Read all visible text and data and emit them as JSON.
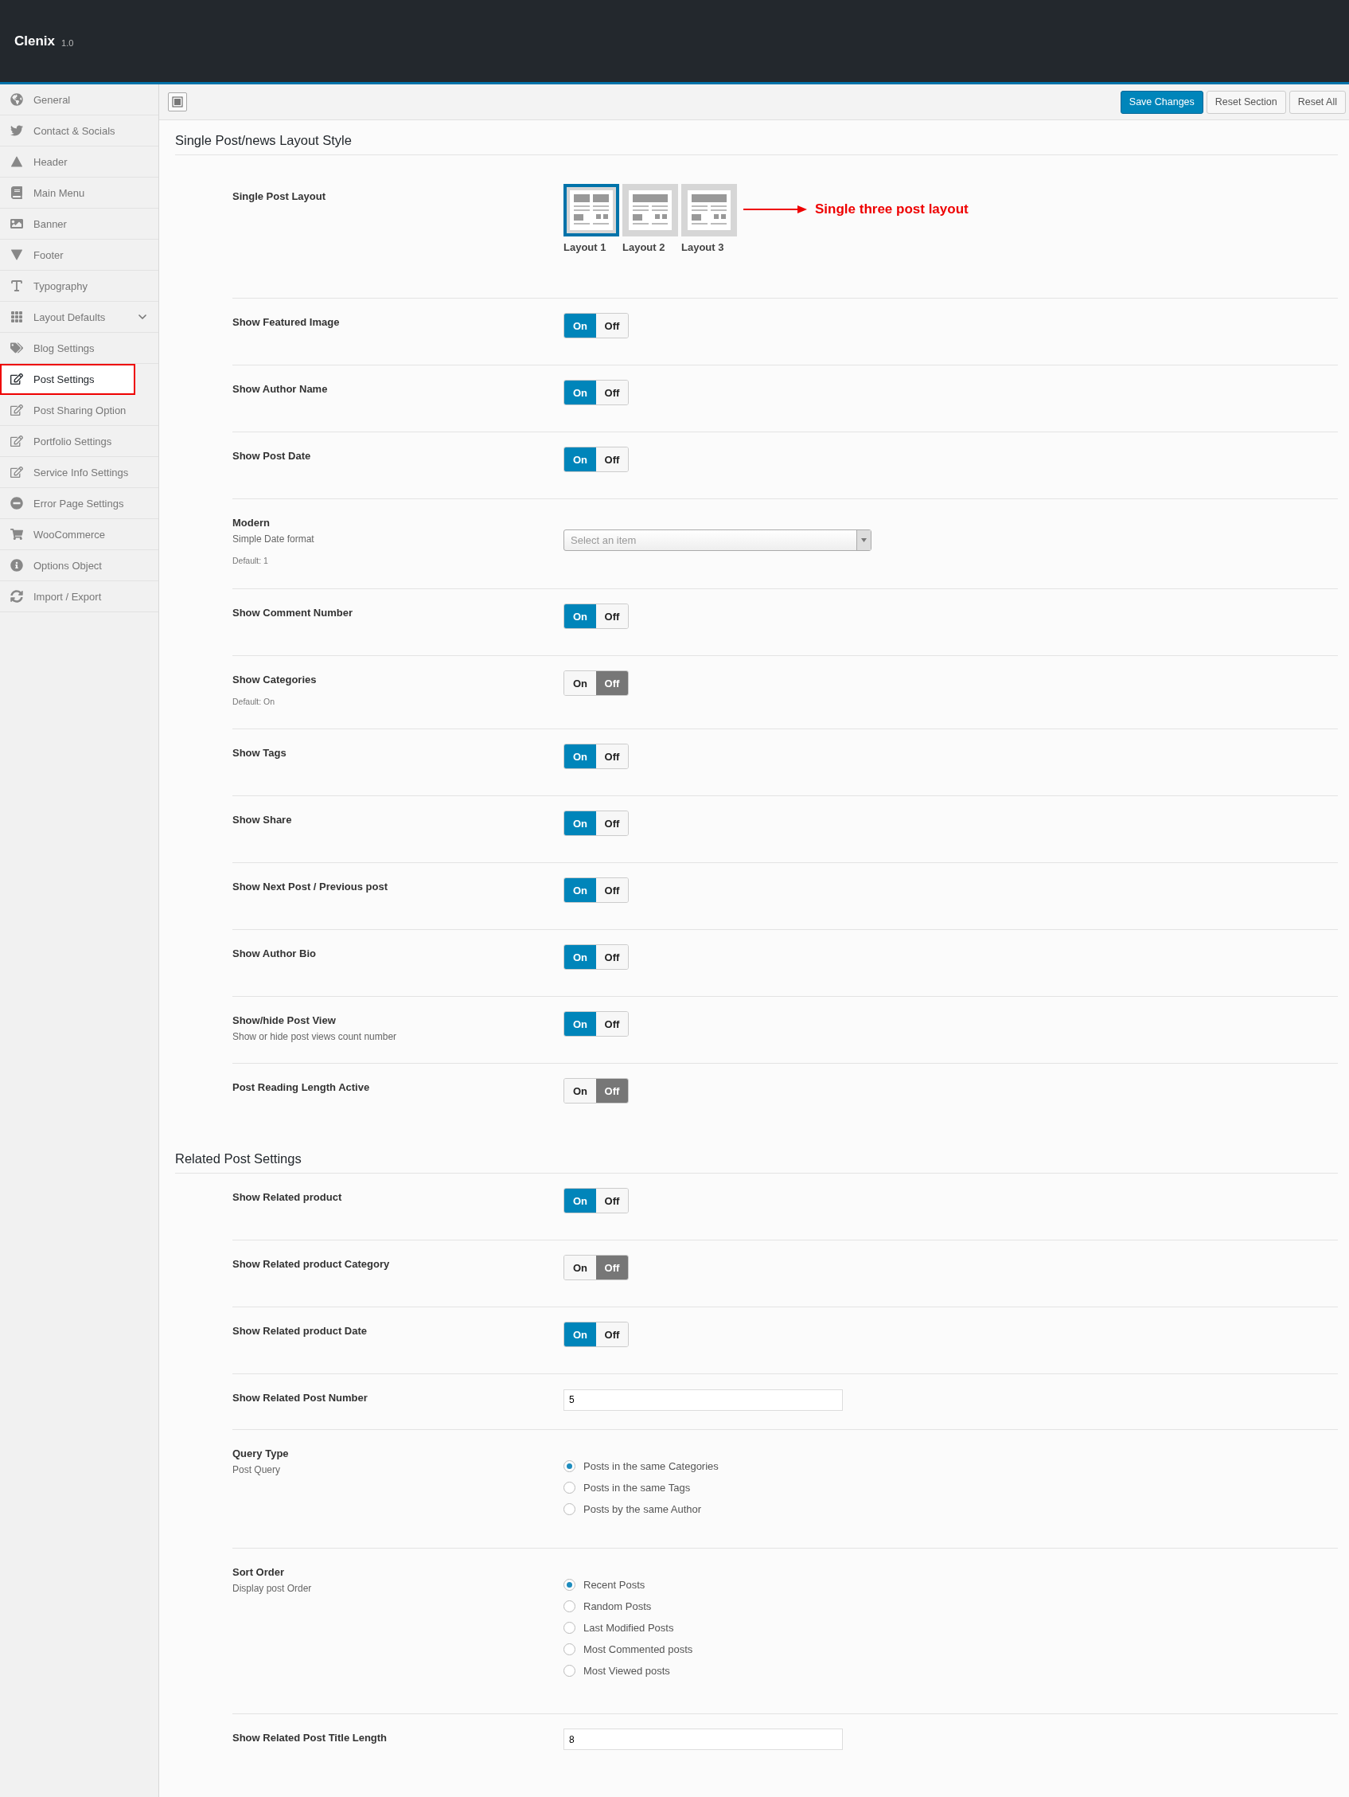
{
  "header": {
    "title": "Clenix",
    "version": "1.0"
  },
  "sidebar": {
    "items": [
      {
        "label": "General",
        "selected": false,
        "has_children": false
      },
      {
        "label": "Contact & Socials",
        "selected": false,
        "has_children": false
      },
      {
        "label": "Header",
        "selected": false,
        "has_children": false
      },
      {
        "label": "Main Menu",
        "selected": false,
        "has_children": false
      },
      {
        "label": "Banner",
        "selected": false,
        "has_children": false
      },
      {
        "label": "Footer",
        "selected": false,
        "has_children": false
      },
      {
        "label": "Typography",
        "selected": false,
        "has_children": false
      },
      {
        "label": "Layout Defaults",
        "selected": false,
        "has_children": true
      },
      {
        "label": "Blog Settings",
        "selected": false,
        "has_children": false
      },
      {
        "label": "Post Settings",
        "selected": true,
        "has_children": false
      },
      {
        "label": "Post Sharing Option",
        "selected": false,
        "has_children": false
      },
      {
        "label": "Portfolio Settings",
        "selected": false,
        "has_children": false
      },
      {
        "label": "Service Info Settings",
        "selected": false,
        "has_children": false
      },
      {
        "label": "Error Page Settings",
        "selected": false,
        "has_children": false
      },
      {
        "label": "WooCommerce",
        "selected": false,
        "has_children": false
      },
      {
        "label": "Options Object",
        "selected": false,
        "has_children": false
      },
      {
        "label": "Import / Export",
        "selected": false,
        "has_children": false
      }
    ]
  },
  "toolbar": {
    "buttons": [
      {
        "label": "Save Changes",
        "kind": "primary"
      },
      {
        "label": "Reset Section",
        "kind": "secondary"
      },
      {
        "label": "Reset All",
        "kind": "secondary"
      }
    ]
  },
  "sections": [
    {
      "title": "Single Post/news Layout Style",
      "fields": [
        {
          "kind": "layout",
          "label": "Single Post Layout",
          "annotation": "Single three post layout",
          "options": [
            {
              "label": "Layout 1",
              "selected": true
            },
            {
              "label": "Layout 2",
              "selected": false
            },
            {
              "label": "Layout 3",
              "selected": false
            }
          ]
        },
        {
          "kind": "toggle",
          "label": "Show Featured Image",
          "on": true,
          "on_label": "On",
          "off_label": "Off"
        },
        {
          "kind": "toggle",
          "label": "Show Author Name",
          "on": true,
          "on_label": "On",
          "off_label": "Off"
        },
        {
          "kind": "toggle",
          "label": "Show Post Date",
          "on": true,
          "on_label": "On",
          "off_label": "Off"
        },
        {
          "kind": "select",
          "label": "Modern",
          "subtitle": "Simple Date format",
          "note": "Default: 1",
          "placeholder": "Select an item"
        },
        {
          "kind": "toggle",
          "label": "Show Comment Number",
          "on": true,
          "on_label": "On",
          "off_label": "Off"
        },
        {
          "kind": "toggle",
          "label": "Show Categories",
          "note": "Default: On",
          "on": false,
          "on_label": "On",
          "off_label": "Off"
        },
        {
          "kind": "toggle",
          "label": "Show Tags",
          "on": true,
          "on_label": "On",
          "off_label": "Off"
        },
        {
          "kind": "toggle",
          "label": "Show Share",
          "on": true,
          "on_label": "On",
          "off_label": "Off"
        },
        {
          "kind": "toggle",
          "label": "Show Next Post / Previous post",
          "on": true,
          "on_label": "On",
          "off_label": "Off"
        },
        {
          "kind": "toggle",
          "label": "Show Author Bio",
          "on": true,
          "on_label": "On",
          "off_label": "Off"
        },
        {
          "kind": "toggle",
          "label": "Show/hide Post View",
          "subtitle": "Show or hide post views count number",
          "on": true,
          "on_label": "On",
          "off_label": "Off"
        },
        {
          "kind": "toggle",
          "label": "Post Reading Length Active",
          "on": false,
          "on_label": "On",
          "off_label": "Off"
        }
      ]
    },
    {
      "title": "Related Post Settings",
      "fields": [
        {
          "kind": "toggle",
          "label": "Show Related product",
          "on": true,
          "on_label": "On",
          "off_label": "Off"
        },
        {
          "kind": "toggle",
          "label": "Show Related product Category",
          "on": false,
          "on_label": "On",
          "off_label": "Off"
        },
        {
          "kind": "toggle",
          "label": "Show Related product Date",
          "on": true,
          "on_label": "On",
          "off_label": "Off"
        },
        {
          "kind": "text",
          "label": "Show Related Post Number",
          "value": "5"
        },
        {
          "kind": "radio",
          "label": "Query Type",
          "subtitle": "Post Query",
          "options": [
            {
              "label": "Posts in the same Categories",
              "selected": true
            },
            {
              "label": "Posts in the same Tags",
              "selected": false
            },
            {
              "label": "Posts by the same Author",
              "selected": false
            }
          ]
        },
        {
          "kind": "radio",
          "label": "Sort Order",
          "subtitle": "Display post Order",
          "options": [
            {
              "label": "Recent Posts",
              "selected": true
            },
            {
              "label": "Random Posts",
              "selected": false
            },
            {
              "label": "Last Modified Posts",
              "selected": false
            },
            {
              "label": "Most Commented posts",
              "selected": false
            },
            {
              "label": "Most Viewed posts",
              "selected": false
            }
          ]
        },
        {
          "kind": "text",
          "label": "Show Related Post Title Length",
          "value": "8"
        }
      ]
    }
  ]
}
